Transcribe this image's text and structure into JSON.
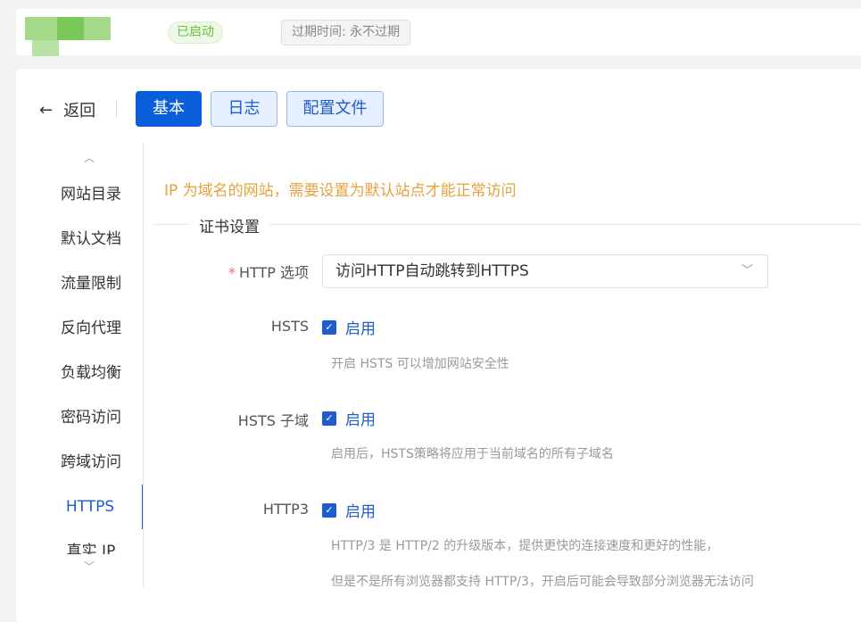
{
  "header": {
    "status_badge": "已启动",
    "expire_label": "过期时间: 永不过期"
  },
  "nav": {
    "back_label": "返回",
    "tabs": [
      {
        "label": "基本"
      },
      {
        "label": "日志"
      },
      {
        "label": "配置文件"
      }
    ]
  },
  "sidebar": {
    "items": [
      {
        "label": "网站目录"
      },
      {
        "label": "默认文档"
      },
      {
        "label": "流量限制"
      },
      {
        "label": "反向代理"
      },
      {
        "label": "负载均衡"
      },
      {
        "label": "密码访问"
      },
      {
        "label": "跨域访问"
      },
      {
        "label": "HTTPS"
      },
      {
        "label": "真实 IP"
      }
    ]
  },
  "content": {
    "warning": "IP 为域名的网站，需要设置为默认站点才能正常访问",
    "section_title": "证书设置",
    "http_option": {
      "label": "HTTP 选项",
      "value": "访问HTTP自动跳转到HTTPS"
    },
    "hsts": {
      "label": "HSTS",
      "checkbox": "启用",
      "desc": "开启 HSTS 可以增加网站安全性"
    },
    "hsts_sub": {
      "label": "HSTS 子域",
      "checkbox": "启用",
      "desc": "启用后，HSTS策略将应用于当前域名的所有子域名"
    },
    "http3": {
      "label": "HTTP3",
      "checkbox": "启用",
      "desc1": "HTTP/3 是 HTTP/2 的升级版本，提供更快的连接速度和更好的性能，",
      "desc2": "但是不是所有浏览器都支持 HTTP/3，开启后可能会导致部分浏览器无法访问"
    }
  }
}
